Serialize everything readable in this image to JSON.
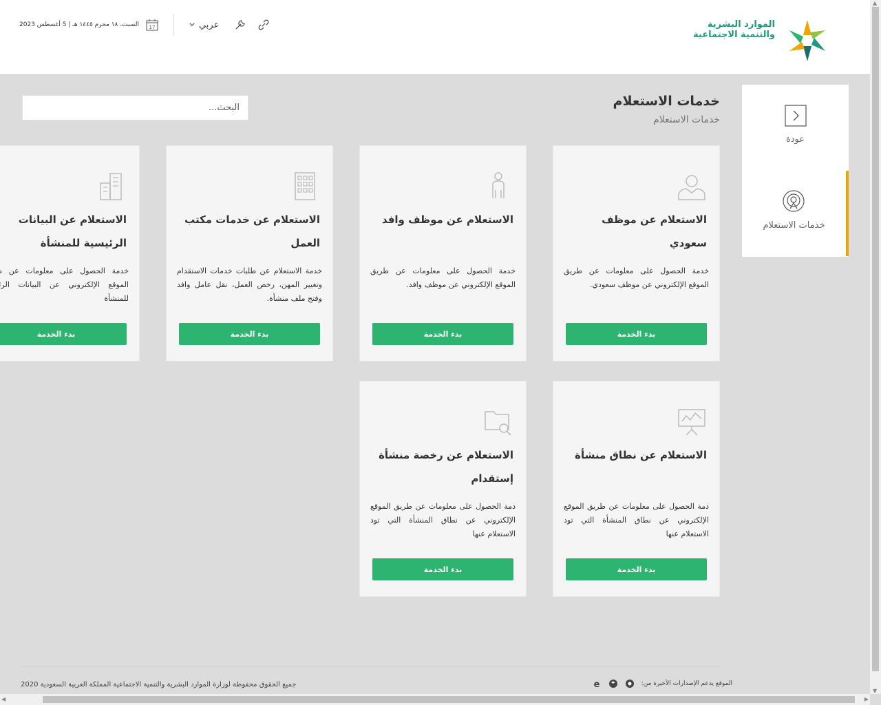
{
  "header": {
    "logo_line1": "الموارد البشرية",
    "logo_line2": "والتنمية الاجتماعية",
    "language": "عربي",
    "date": "السبت، ١٨ محرم ١٤٤٥ هـ | 5 أغسطس 2023",
    "calendar_day": "17"
  },
  "sidebar": {
    "back_label": "عودة",
    "active_label": "خدمات الاستعلام"
  },
  "main": {
    "title": "خدمات الاستعلام",
    "breadcrumb": "خدمات الاستعلام",
    "search_placeholder": "البحث..."
  },
  "cards": [
    {
      "title": "الاستعلام عن موظف سعودي",
      "desc": "خدمة الحصول على معلومات عن طريق الموقع الإلكتروني عن موظف سعودي.",
      "button": "بدء الخدمة",
      "icon": "user-icon"
    },
    {
      "title": "الاستعلام عن موظف وافد",
      "desc": "خدمة الحصول على معلومات عن طريق الموقع الإلكتروني عن موظف وافد.",
      "button": "بدء الخدمة",
      "icon": "person-icon"
    },
    {
      "title": "الاستعلام عن خدمات مكتب العمل",
      "desc": "خدمة الاستعلام عن طلبات خدمات الاستقدام وتغيير المهن، رخص العمل، نقل عامل وافد وفتح ملف منشأة.",
      "button": "بدء الخدمة",
      "icon": "building-icon"
    },
    {
      "title": "الاستعلام عن البيانات الرئيسية للمنشأة",
      "desc": "خدمة الحصول على معلومات عن طريق الموقع الإلكتروني عن البيانات الرئيسية للمنشأة",
      "button": "بدء الخدمة",
      "icon": "buildings-icon"
    },
    {
      "title": "الاستعلام عن نطاق منشأة",
      "desc": "دمة الحصول على معلومات عن طريق الموقع الإلكتروني عن نطاق المنشأة التي تود الاستعلام عنها",
      "button": "بدء الخدمة",
      "icon": "presentation-chart-icon"
    },
    {
      "title": "الاستعلام عن رخصة منشأة إستقدام",
      "desc": "دمة الحصول على معلومات عن طريق الموقع الإلكتروني عن نطاق المنشأة التي تود الاستعلام عنها",
      "button": "بدء الخدمة",
      "icon": "folder-search-icon"
    }
  ],
  "footer": {
    "copyright": "جميع الحقوق محفوظة لوزارة الموارد البشرية والتنمية الاجتماعية المملكة العربية السعودية 2020",
    "browsers_text": "الموقع يدعم الإصدارات الأخيرة من:"
  },
  "colors": {
    "accent_green": "#2db471",
    "active_orange": "#f0a500",
    "logo_teal": "#1f9a7e"
  }
}
